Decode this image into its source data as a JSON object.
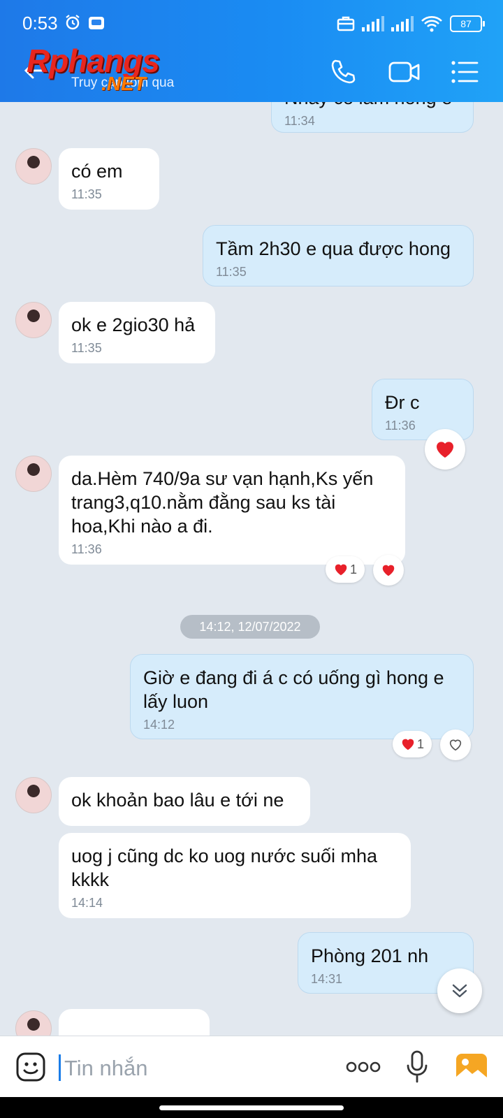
{
  "status": {
    "time": "0:53",
    "battery": "87"
  },
  "header": {
    "logo_text": "Rphangs",
    "logo_suffix": ".NET",
    "subtitle": "Truy cập tôm qua"
  },
  "messages": [
    {
      "dir": "out",
      "text": "Nhay co lam hong e",
      "time": "11:34"
    },
    {
      "dir": "in",
      "text": "có em",
      "time": "11:35"
    },
    {
      "dir": "out",
      "text": "Tầm 2h30 e qua được hong",
      "time": "11:35"
    },
    {
      "dir": "in",
      "text": "ok e 2gio30 hả",
      "time": "11:35"
    },
    {
      "dir": "out",
      "text": "Đr c",
      "time": "11:36"
    },
    {
      "dir": "in",
      "text": "da.Hèm 740/9a sư vạn hạnh,Ks yến trang3,q10.nằm đằng sau ks tài hoa,Khi nào a đi.",
      "time": "11:36"
    },
    {
      "dir": "out",
      "text": "Giờ e đang đi á c có uống gì hong e lấy luon",
      "time": "14:12"
    },
    {
      "dir": "in",
      "text": "ok khoản bao lâu e tới ne",
      "time": ""
    },
    {
      "dir": "in",
      "text": "uog j cũng dc ko uog nước suối mha kkkk",
      "time": "14:14"
    },
    {
      "dir": "out",
      "text": "Phòng 201 nh",
      "time": "14:31"
    }
  ],
  "reactions": {
    "count_a": "1",
    "count_b": "1"
  },
  "date_divider": "14:12, 12/07/2022",
  "input": {
    "placeholder": "Tin nhắn",
    "value": ""
  },
  "colors": {
    "header": "#1a8cf3",
    "bubble_out": "#d6ecfb",
    "bubble_in": "#ffffff",
    "heart": "#e8202a"
  }
}
